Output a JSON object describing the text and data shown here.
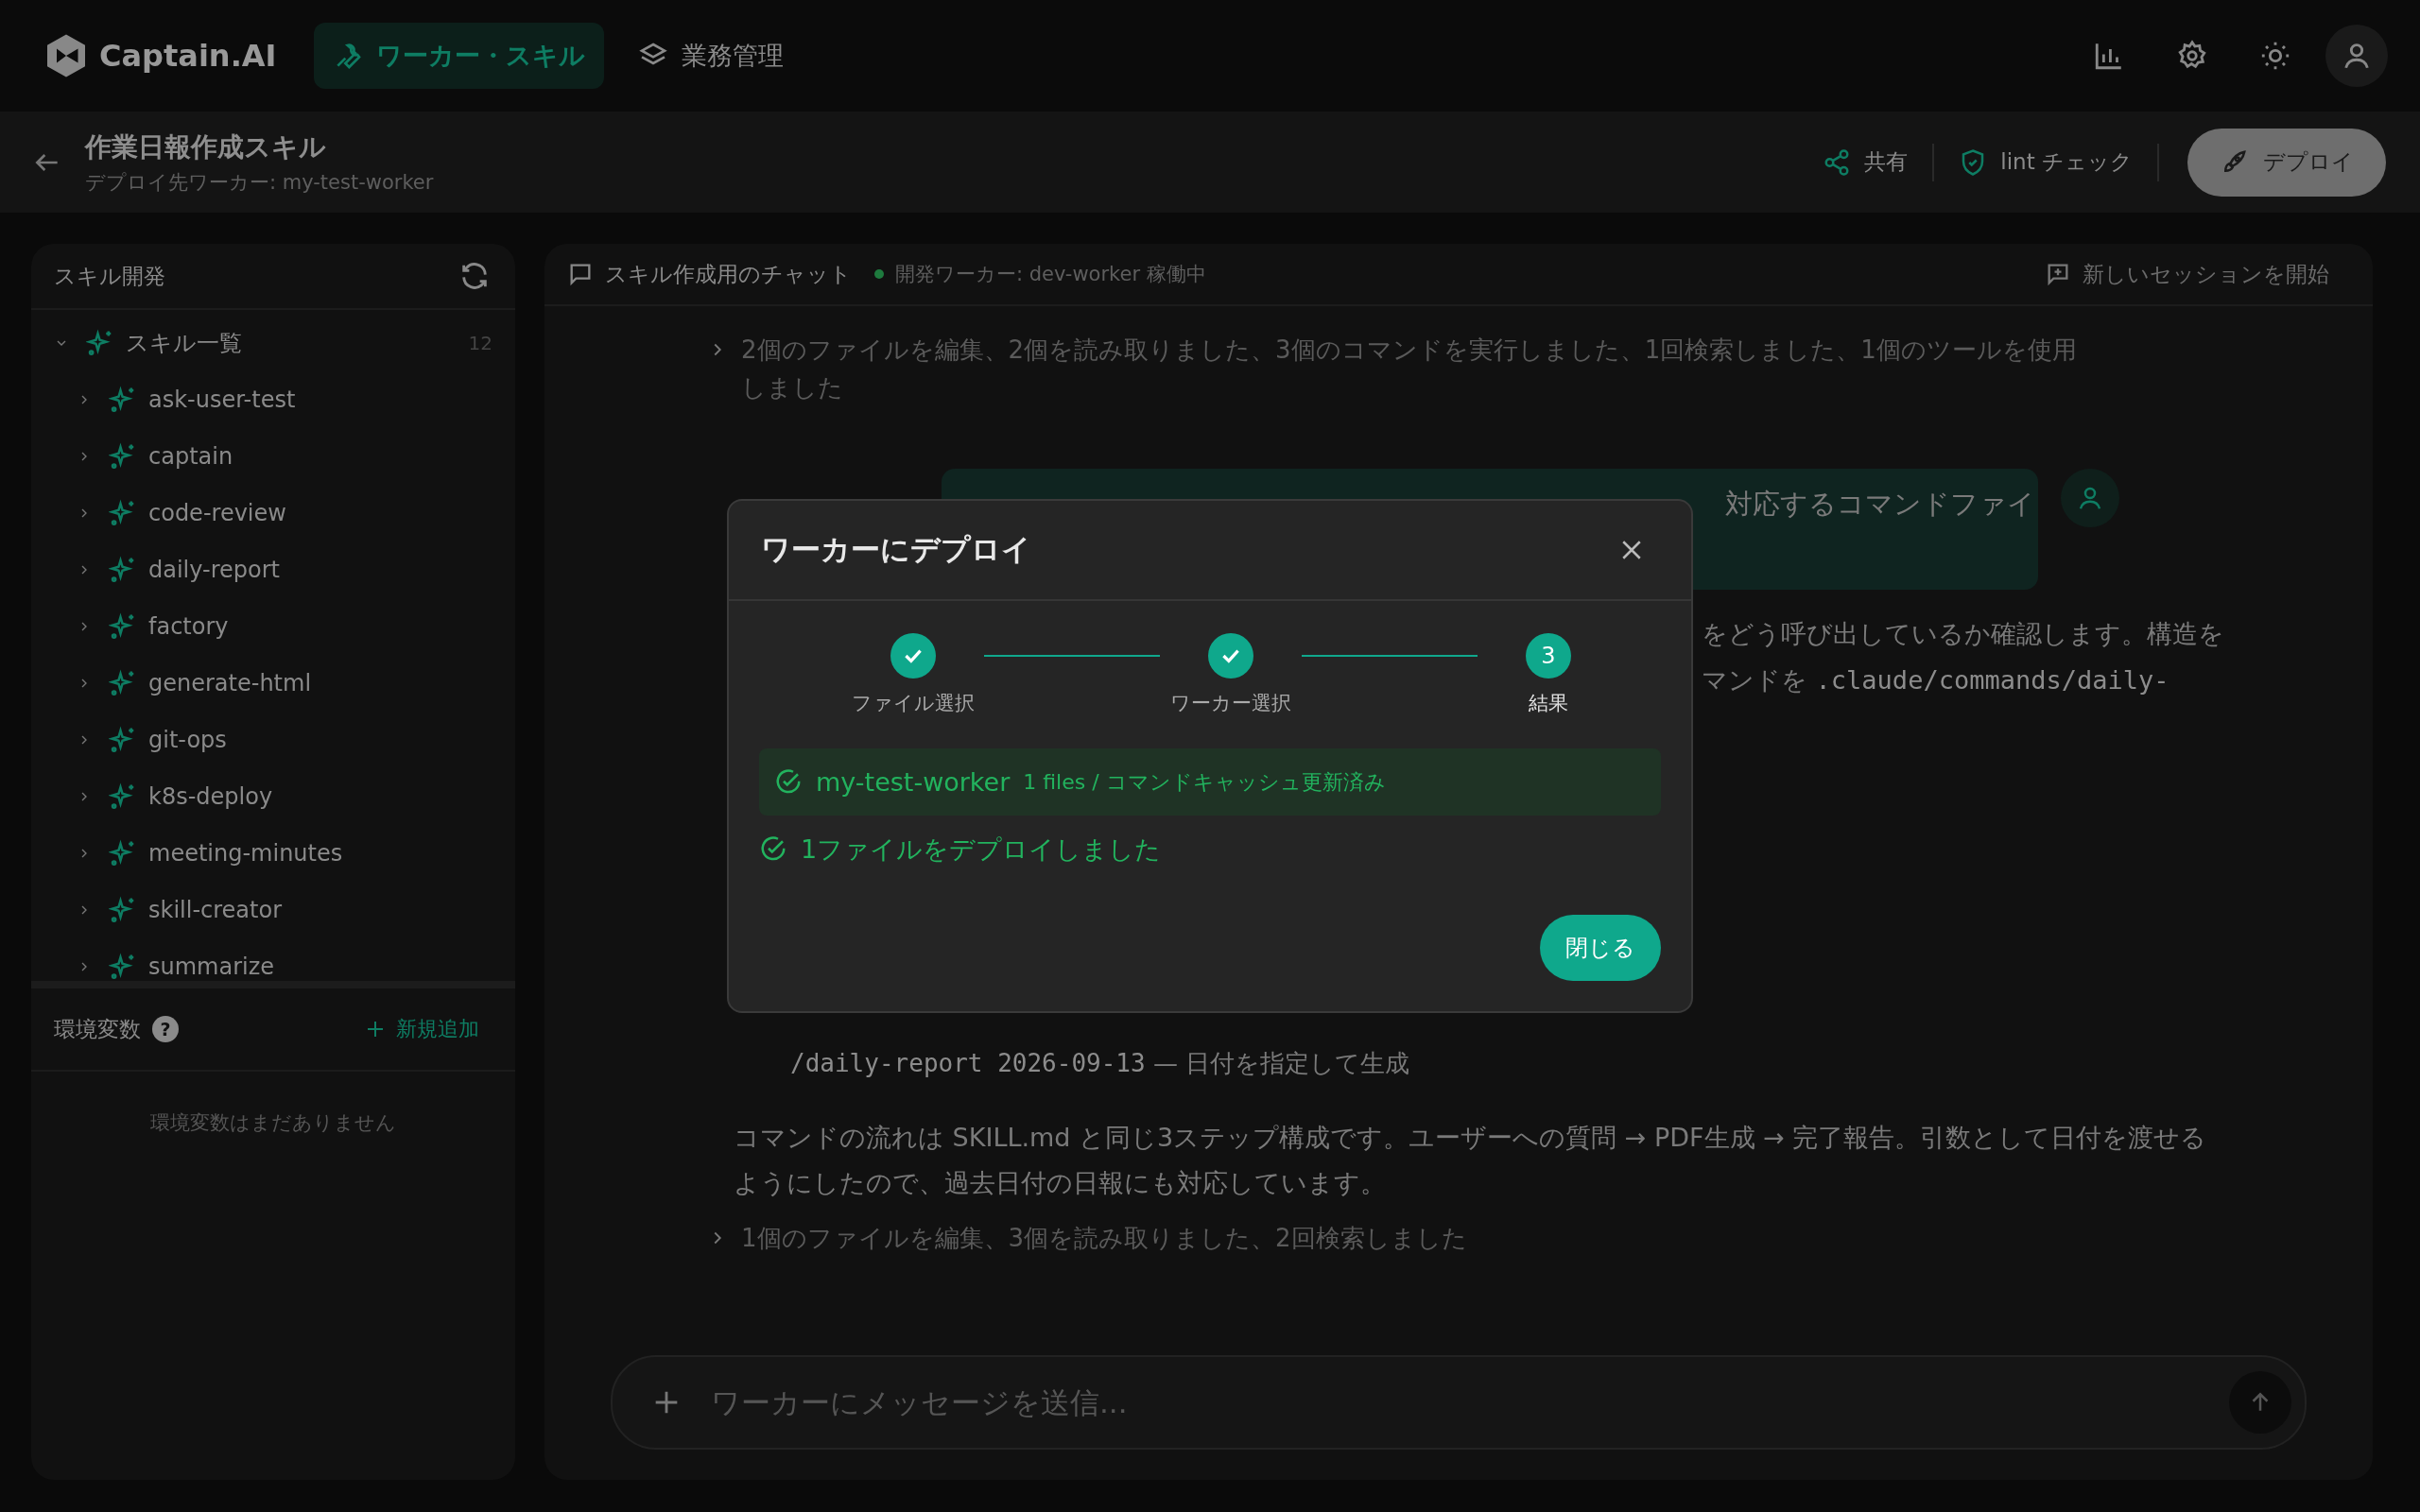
{
  "header": {
    "logo": "Captain.AI",
    "nav": [
      {
        "label": "ワーカー・スキル",
        "selected": true
      },
      {
        "label": "業務管理",
        "selected": false
      }
    ]
  },
  "subheader": {
    "title": "作業日報作成スキル",
    "subtitle": "デプロイ先ワーカー: my-test-worker",
    "actions": [
      "共有",
      "lint チェック"
    ],
    "deploy_button": "デプロイ"
  },
  "sidebar": {
    "title": "スキル開発",
    "tree": {
      "label": "スキル一覧",
      "count": "12",
      "expanded": true,
      "children": [
        {
          "label": "ask-user-test",
          "expanded": false
        },
        {
          "label": "captain",
          "expanded": false
        },
        {
          "label": "code-review",
          "expanded": false
        },
        {
          "label": "daily-report",
          "expanded": false
        },
        {
          "label": "factory",
          "expanded": false
        },
        {
          "label": "generate-html",
          "expanded": false
        },
        {
          "label": "git-ops",
          "expanded": false
        },
        {
          "label": "k8s-deploy",
          "expanded": false
        },
        {
          "label": "meeting-minutes",
          "expanded": false
        },
        {
          "label": "skill-creator",
          "expanded": false
        },
        {
          "label": "summarize",
          "expanded": false
        }
      ]
    },
    "env": {
      "title": "環境変数",
      "help": "?",
      "add": "新規追加",
      "empty": "環境変数はまだありません"
    }
  },
  "chat": {
    "title": "スキル作成用のチャット",
    "status": "開発ワーカー: dev-worker 稼働中",
    "new_session": "新しいセッションを開始",
    "messages": [
      {
        "kind": "activity",
        "text": "2個のファイルを編集、2個を読み取りました、3個のコマンドを実行しました、1回検索しました、1個のツールを使用しました"
      },
      {
        "kind": "user",
        "text": "対応するコマンドファイ"
      },
      {
        "kind": "partial",
        "lines": [
          [
            {
              "text": "をどう呼び出しているか確認します。構造を",
              "code": false
            }
          ],
          [
            {
              "text": "マンドを ",
              "code": false
            },
            {
              "text": ".claude/commands/daily-",
              "code": true
            }
          ]
        ]
      },
      {
        "kind": "command",
        "code": "/daily-report 2026-09-13",
        "desc": "— 日付を指定して生成"
      },
      {
        "kind": "paragraph",
        "text": "コマンドの流れは SKILL.md と同じ3ステップ構成です。ユーザーへの質問 → PDF生成 → 完了報告。引数として日付を渡せるようにしたので、過去日付の日報にも対応しています。"
      },
      {
        "kind": "activity",
        "text": "1個のファイルを編集、3個を読み取りました、2回検索しました"
      }
    ],
    "input": {
      "placeholder": "ワーカーにメッセージを送信..."
    }
  },
  "modal": {
    "title": "ワーカーにデプロイ",
    "steps": [
      {
        "label": "ファイル選択",
        "completed": true,
        "selected": false
      },
      {
        "label": "ワーカー選択",
        "completed": true,
        "selected": false
      },
      {
        "label": "結果",
        "completed": false,
        "selected": true,
        "number": "3"
      }
    ],
    "result": {
      "worker": "my-test-worker",
      "detail": "1 files / コマンドキャッシュ更新済み"
    },
    "summary": "1ファイルをデプロイしました",
    "close_button": "閉じる"
  }
}
